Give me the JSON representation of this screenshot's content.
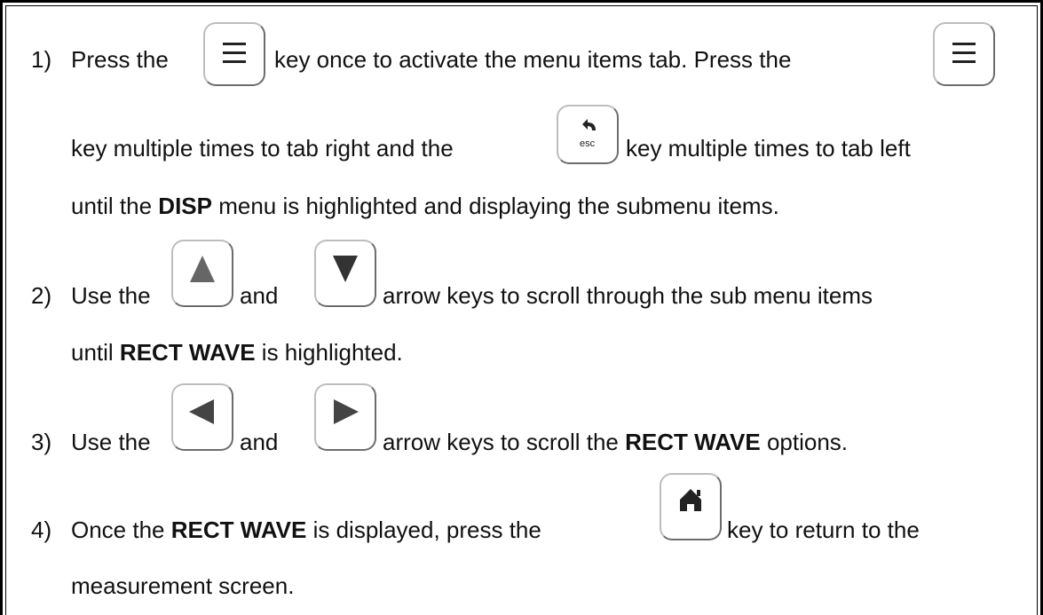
{
  "steps": [
    {
      "number": "1)",
      "l1a": "Press the",
      "l1b": "key once to activate the menu items tab.  Press the",
      "l2a": "key multiple times to tab right and the",
      "l2b": "key multiple times to tab left",
      "l3a": "until the ",
      "l3bold": "DISP",
      "l3b": " menu is highlighted and displaying the submenu items."
    },
    {
      "number": "2)",
      "l1a": "Use the",
      "l1and": "and",
      "l1b": "arrow keys to scroll through the sub menu items",
      "l2a": "until ",
      "l2bold": "RECT WAVE",
      "l2b": " is highlighted."
    },
    {
      "number": "3)",
      "l1a": "Use the",
      "l1and": "and",
      "l1b": "arrow keys to scroll the ",
      "l1bold": "RECT WAVE",
      "l1c": " options."
    },
    {
      "number": "4)",
      "l1a": "Once the ",
      "l1bold": "RECT WAVE",
      "l1b": " is displayed, press the",
      "l1c": "key to return to the",
      "l2": "measurement screen."
    }
  ],
  "keys": {
    "menu": "menu-icon",
    "esc": "esc",
    "up": "up-arrow-icon",
    "down": "down-arrow-icon",
    "left": "left-arrow-icon",
    "right": "right-arrow-icon",
    "home": "home-icon"
  }
}
